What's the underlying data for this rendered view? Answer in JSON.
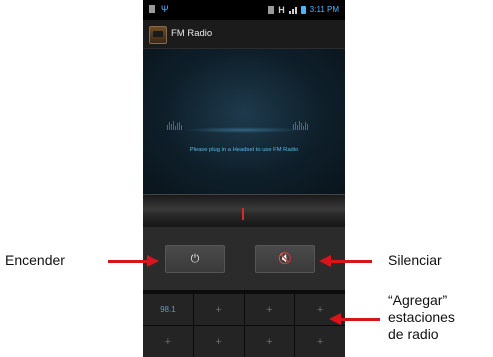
{
  "status_bar": {
    "time": "3:11 PM",
    "network_type": "H",
    "icons": [
      "sd-card-icon",
      "usb-icon",
      "sim-icon",
      "network-h-icon",
      "signal-icon",
      "battery-icon"
    ]
  },
  "app": {
    "title": "FM Radio",
    "icon": "radio-icon"
  },
  "display": {
    "message": "Please plug in a Headset to use FM Radio"
  },
  "controls": {
    "power_icon": "⏻",
    "mute_icon": "🔇"
  },
  "presets": {
    "row1": [
      "98.1",
      "+",
      "+",
      "+"
    ],
    "row2": [
      "+",
      "+",
      "+",
      "+"
    ]
  },
  "annotations": {
    "power": "Encender",
    "mute": "Silenciar",
    "add_line1": "“Agregar”",
    "add_line2": "estaciones",
    "add_line3": "de radio"
  },
  "colors": {
    "annotation_arrow": "#d9141b",
    "accent": "#4fb3ff"
  }
}
